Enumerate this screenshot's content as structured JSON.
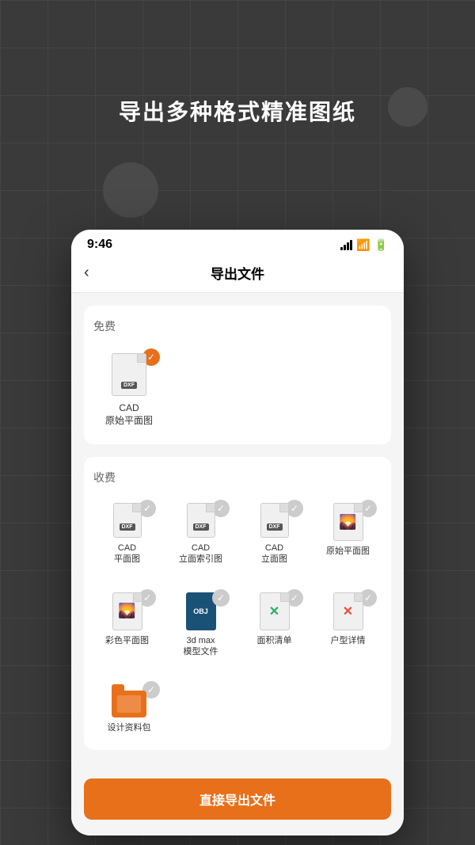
{
  "background": {
    "title": "导出多种格式精准图纸"
  },
  "statusBar": {
    "time": "9:46"
  },
  "navBar": {
    "backLabel": "‹",
    "title": "导出文件"
  },
  "sections": {
    "free": {
      "label": "免费",
      "items": [
        {
          "id": "cad-original",
          "name": "CAD\n原始平面图",
          "type": "dxf",
          "selected": true
        }
      ]
    },
    "paid": {
      "label": "收费",
      "row1": [
        {
          "id": "cad-plan",
          "name": "CAD\n平面图",
          "type": "dxf",
          "selected": false
        },
        {
          "id": "cad-facade-index",
          "name": "CAD\n立面索引图",
          "type": "dxf",
          "selected": false
        },
        {
          "id": "cad-facade",
          "name": "CAD\n立面图",
          "type": "dxf",
          "selected": false
        },
        {
          "id": "original-plan",
          "name": "原始平面图",
          "type": "image",
          "selected": false
        }
      ],
      "row2": [
        {
          "id": "color-plan",
          "name": "彩色平面图",
          "type": "image",
          "selected": false
        },
        {
          "id": "3dmax",
          "name": "3d max\n模型文件",
          "type": "obj",
          "selected": false
        },
        {
          "id": "area-list",
          "name": "面积清单",
          "type": "excel-green",
          "selected": false
        },
        {
          "id": "unit-detail",
          "name": "户型详情",
          "type": "excel-red",
          "selected": false
        }
      ],
      "row3": [
        {
          "id": "design-pack",
          "name": "设计资料包",
          "type": "folder",
          "selected": false
        }
      ]
    }
  },
  "button": {
    "label": "直接导出文件"
  }
}
